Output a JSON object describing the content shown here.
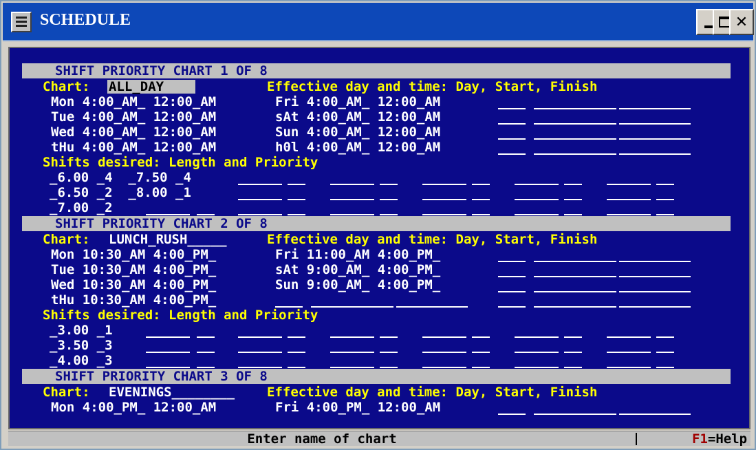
{
  "window": {
    "title": "SCHEDULE"
  },
  "charts": [
    {
      "header": "SHIFT PRIORITY CHART 1 OF 8",
      "chart_label": "Chart:",
      "chart_name": "ALL_DAY",
      "effective_label": "Effective day and time: Day, Start, Finish",
      "days_left": [
        "Mon 4:00_AM_ 12:00_AM",
        "Tue 4:00_AM_ 12:00_AM",
        "Wed 4:00_AM_ 12:00_AM",
        "tHu 4:00_AM_ 12:00_AM"
      ],
      "days_right": [
        "Fri 4:00_AM_ 12:00_AM",
        "sAt 4:00_AM_ 12:00_AM",
        "Sun 4:00_AM_ 12:00_AM",
        "h0l 4:00_AM_ 12:00_AM"
      ],
      "shifts_label": "Shifts desired: Length and Priority",
      "shift_lines": [
        "_6.00 _4  _7.50 _4",
        "_6.50 _2  _8.00 _1",
        "_7.00 _2"
      ]
    },
    {
      "header": "SHIFT PRIORITY CHART 2 OF 8",
      "chart_label": "Chart:",
      "chart_name": "LUNCH_RUSH_____",
      "effective_label": "Effective day and time: Day, Start, Finish",
      "days_left": [
        "Mon 10:30_AM 4:00_PM_",
        "Tue 10:30_AM 4:00_PM_",
        "Wed 10:30_AM 4:00_PM_",
        "tHu 10:30_AM 4:00_PM_"
      ],
      "days_right": [
        "Fri 11:00_AM 4:00_PM_",
        "sAt 9:00_AM_ 4:00_PM_",
        "Sun 9:00_AM_ 4:00_PM_"
      ],
      "shifts_label": "Shifts desired: Length and Priority",
      "shift_lines": [
        "_3.00 _1",
        "_3.50 _3",
        "_4.00 _3"
      ]
    },
    {
      "header": "SHIFT PRIORITY CHART 3 OF 8",
      "chart_label": "Chart:",
      "chart_name": "EVENINGS________",
      "effective_label": "Effective day and time: Day, Start, Finish",
      "days_left": [
        "Mon 4:00_PM_ 12:00_AM"
      ],
      "days_right": [
        "Fri 4:00_PM_ 12:00_AM"
      ]
    }
  ],
  "status": {
    "prompt": "Enter name of chart",
    "help_key": "F1",
    "help_text": "=Help"
  }
}
